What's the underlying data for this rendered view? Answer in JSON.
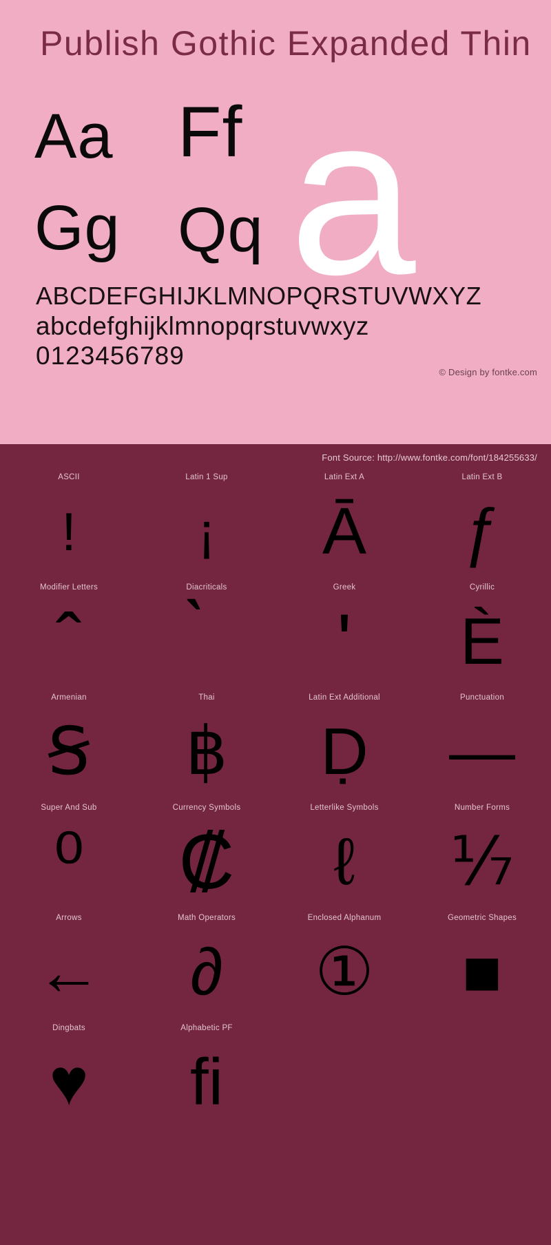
{
  "specimen": {
    "title": "Publish Gothic Expanded Thin",
    "letter_pairs": [
      {
        "name": "pair-a",
        "text": "Aa"
      },
      {
        "name": "pair-f",
        "text": "Ff"
      },
      {
        "name": "pair-g",
        "text": "Gg"
      },
      {
        "name": "pair-q",
        "text": "Qq"
      }
    ],
    "feature_letter": "a",
    "alphabet_upper": "ABCDEFGHIJKLMNOPQRSTUVWXYZ",
    "alphabet_lower": "abcdefghijklmnopqrstuvwxyz",
    "digits": "0123456789",
    "credit": "© Design by fontke.com"
  },
  "source": {
    "text": "Font Source: http://www.fontke.com/font/184255633/"
  },
  "unicode_blocks": [
    {
      "label": "ASCII",
      "glyph": "!",
      "size": "g-md"
    },
    {
      "label": "Latin 1 Sup",
      "glyph": "¡",
      "size": "g-md"
    },
    {
      "label": "Latin Ext A",
      "glyph": "Ā",
      "size": "g-lg"
    },
    {
      "label": "Latin Ext B",
      "glyph": "ƒ",
      "size": "g-lg"
    },
    {
      "label": "Modifier Letters",
      "glyph": "ˆ",
      "size": "g-xl"
    },
    {
      "label": "Diacriticals",
      "glyph": "̀",
      "size": "g-xl"
    },
    {
      "label": "Greek",
      "glyph": "ʹ",
      "size": "g-xl"
    },
    {
      "label": "Cyrillic",
      "glyph": "Ѐ",
      "size": "g-lg"
    },
    {
      "label": "Armenian",
      "glyph": "Ꞩ",
      "size": "g-lg"
    },
    {
      "label": "Thai",
      "glyph": "฿",
      "size": "g-lg"
    },
    {
      "label": "Latin Ext Additional",
      "glyph": "Ḍ",
      "size": "g-lg"
    },
    {
      "label": "Punctuation",
      "glyph": "—",
      "size": "g-lg"
    },
    {
      "label": "Super And Sub",
      "glyph": "⁰",
      "size": "g-xl"
    },
    {
      "label": "Currency Symbols",
      "glyph": "₡",
      "size": "g-xl"
    },
    {
      "label": "Letterlike Symbols",
      "glyph": "ℓ",
      "size": "g-lg"
    },
    {
      "label": "Number Forms",
      "glyph": "⅐",
      "size": "g-lg"
    },
    {
      "label": "Arrows",
      "glyph": "←",
      "size": "g-lg"
    },
    {
      "label": "Math Operators",
      "glyph": "∂",
      "size": "g-lg"
    },
    {
      "label": "Enclosed Alphanum",
      "glyph": "①",
      "size": "g-lg"
    },
    {
      "label": "Geometric Shapes",
      "glyph": "■",
      "size": "g-lg g-solid"
    },
    {
      "label": "Dingbats",
      "glyph": "♥",
      "size": "g-lg g-solid"
    },
    {
      "label": "Alphabetic PF",
      "glyph": "ﬁ",
      "size": "g-lg"
    }
  ],
  "colors": {
    "specimen_bg": "#f1adc3",
    "blocks_bg": "#742640",
    "title": "#7a2b45",
    "glyph": "#000000",
    "feature_letter": "#ffffff",
    "label": "#e2c4cf"
  }
}
